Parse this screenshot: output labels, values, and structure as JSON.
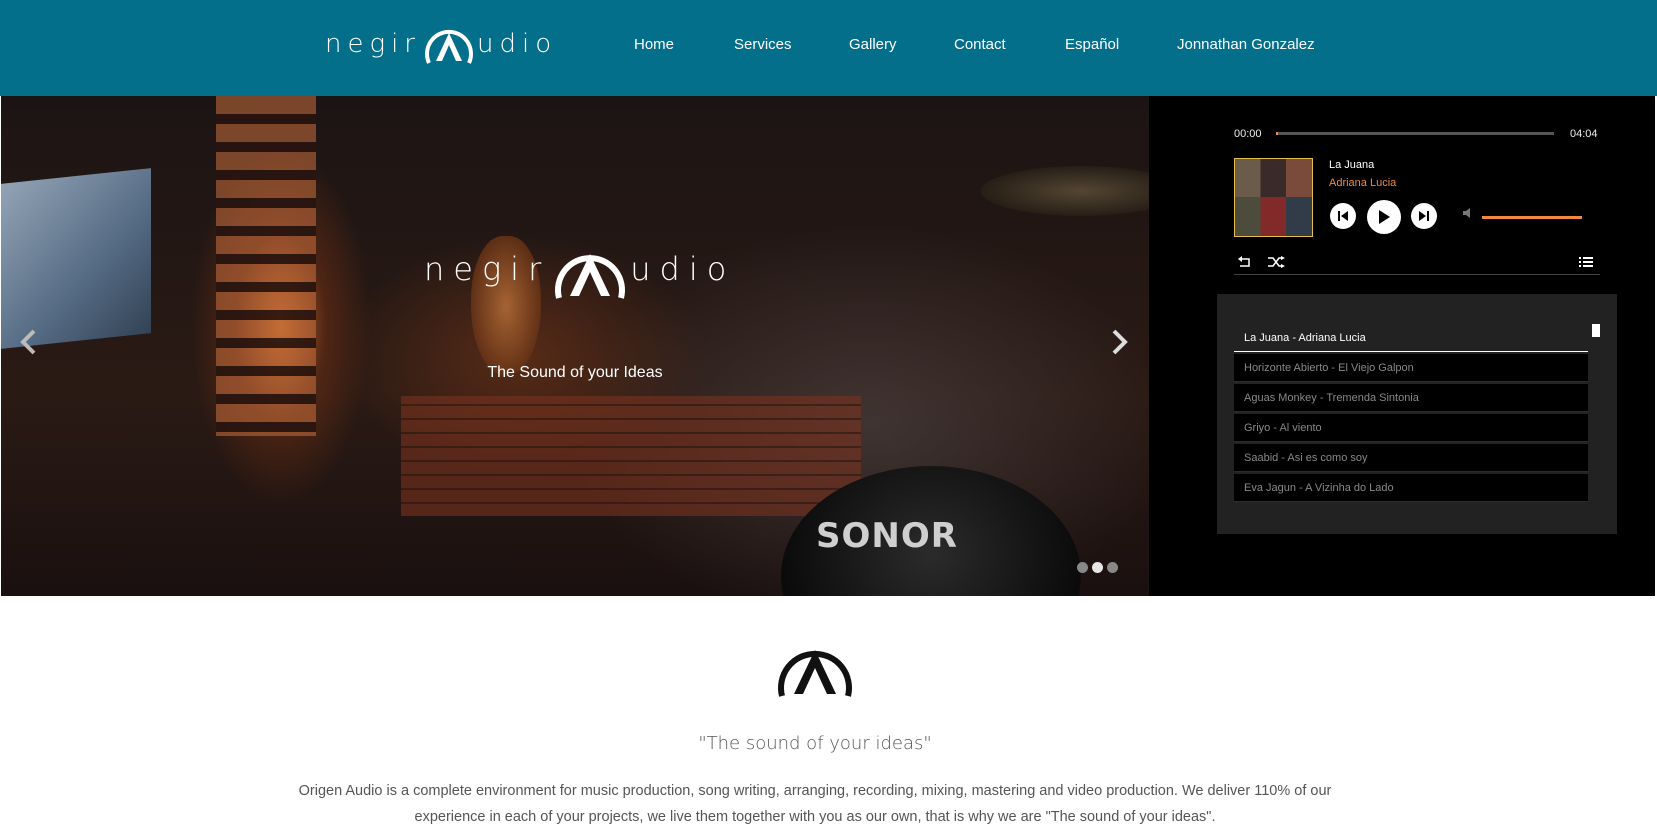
{
  "brand": {
    "logo_left": "negir",
    "logo_right": "udio",
    "accent": "#036f8b"
  },
  "nav": {
    "items": [
      "Home",
      "Services",
      "Gallery",
      "Contact",
      "Español",
      "Jonnathan Gonzalez"
    ]
  },
  "hero": {
    "tagline": "The Sound of your Ideas",
    "drum_brand": "SONOR",
    "prev_icon": "chevron-left-icon",
    "next_icon": "chevron-right-icon",
    "slide_count": 3,
    "active_slide": 2
  },
  "player": {
    "current_time": "00:00",
    "duration": "04:04",
    "progress": 0.0,
    "volume": 1.0,
    "song_title": "La Juana",
    "song_artist": "Adriana Lucia",
    "accent": "#f08a3c",
    "playlist": [
      "La Juana - Adriana Lucia",
      "Horizonte Abierto - El Viejo Galpon",
      "Aguas Monkey - Tremenda Sintonia",
      "Griyo - Al viento",
      "Saabid - Asi es como soy",
      "Eva Jagun - A Vizinha do Lado"
    ],
    "current_index": 0
  },
  "about": {
    "slogan": "\"The sound of your ideas\"",
    "description": "Origen Audio is a complete environment for music production, song writing, arranging, recording, mixing, mastering and video production. We deliver 110% of our experience in each of your projects, we live them together with you as our own, that is why we are \"The sound of your ideas\"."
  }
}
